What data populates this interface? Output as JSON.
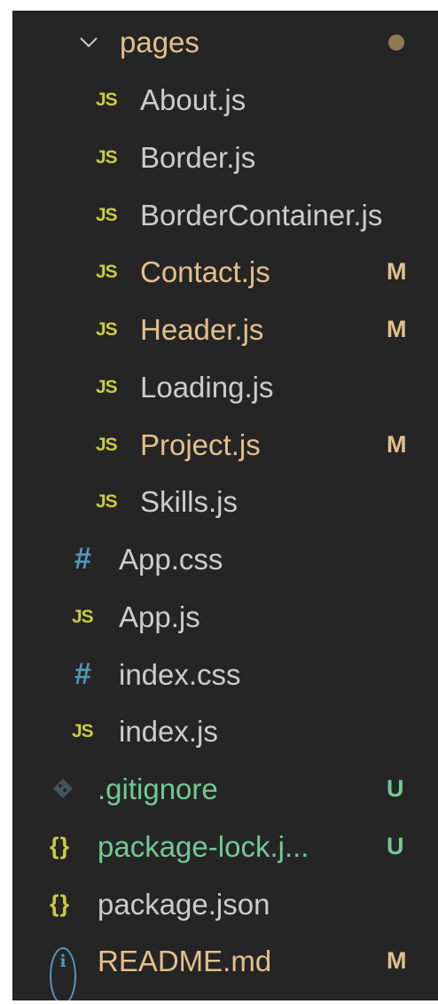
{
  "explorer": {
    "folder": {
      "name": "pages",
      "expanded": true,
      "icon": "chevron-down-icon",
      "badge_color": "#8e7a52"
    },
    "items": [
      {
        "icon_text": "JS",
        "icon_type": "javascript-icon",
        "name": "About.js",
        "status": "",
        "name_color": "#cccccc",
        "status_color": ""
      },
      {
        "icon_text": "JS",
        "icon_type": "javascript-icon",
        "name": "Border.js",
        "status": "",
        "name_color": "#cccccc",
        "status_color": ""
      },
      {
        "icon_text": "JS",
        "icon_type": "javascript-icon",
        "name": "BorderContainer.js",
        "status": "",
        "name_color": "#cccccc",
        "status_color": ""
      },
      {
        "icon_text": "JS",
        "icon_type": "javascript-icon",
        "name": "Contact.js",
        "status": "M",
        "name_color": "#e2c08d",
        "status_color": "#e2c08d"
      },
      {
        "icon_text": "JS",
        "icon_type": "javascript-icon",
        "name": "Header.js",
        "status": "M",
        "name_color": "#e2c08d",
        "status_color": "#e2c08d"
      },
      {
        "icon_text": "JS",
        "icon_type": "javascript-icon",
        "name": "Loading.js",
        "status": "",
        "name_color": "#cccccc",
        "status_color": ""
      },
      {
        "icon_text": "JS",
        "icon_type": "javascript-icon",
        "name": "Project.js",
        "status": "M",
        "name_color": "#e2c08d",
        "status_color": "#e2c08d"
      },
      {
        "icon_text": "JS",
        "icon_type": "javascript-icon",
        "name": "Skills.js",
        "status": "",
        "name_color": "#cccccc",
        "status_color": ""
      },
      {
        "icon_text": "#",
        "icon_type": "css-icon",
        "name": "App.css",
        "status": "",
        "name_color": "#cccccc",
        "status_color": ""
      },
      {
        "icon_text": "JS",
        "icon_type": "javascript-icon",
        "name": "App.js",
        "status": "",
        "name_color": "#cccccc",
        "status_color": ""
      },
      {
        "icon_text": "#",
        "icon_type": "css-icon",
        "name": "index.css",
        "status": "",
        "name_color": "#cccccc",
        "status_color": ""
      },
      {
        "icon_text": "JS",
        "icon_type": "javascript-icon",
        "name": "index.js",
        "status": "",
        "name_color": "#cccccc",
        "status_color": ""
      },
      {
        "icon_text": "",
        "icon_type": "git-icon",
        "name": ".gitignore",
        "status": "U",
        "name_color": "#73c991",
        "status_color": "#73c991"
      },
      {
        "icon_text": "{}",
        "icon_type": "json-icon",
        "name": "package-lock.j...",
        "status": "U",
        "name_color": "#73c991",
        "status_color": "#73c991"
      },
      {
        "icon_text": "{}",
        "icon_type": "json-icon",
        "name": "package.json",
        "status": "",
        "name_color": "#cccccc",
        "status_color": ""
      },
      {
        "icon_text": "i",
        "icon_type": "info-icon",
        "name": "README.md",
        "status": "M",
        "name_color": "#e2c08d",
        "status_color": "#e2c08d"
      }
    ]
  }
}
